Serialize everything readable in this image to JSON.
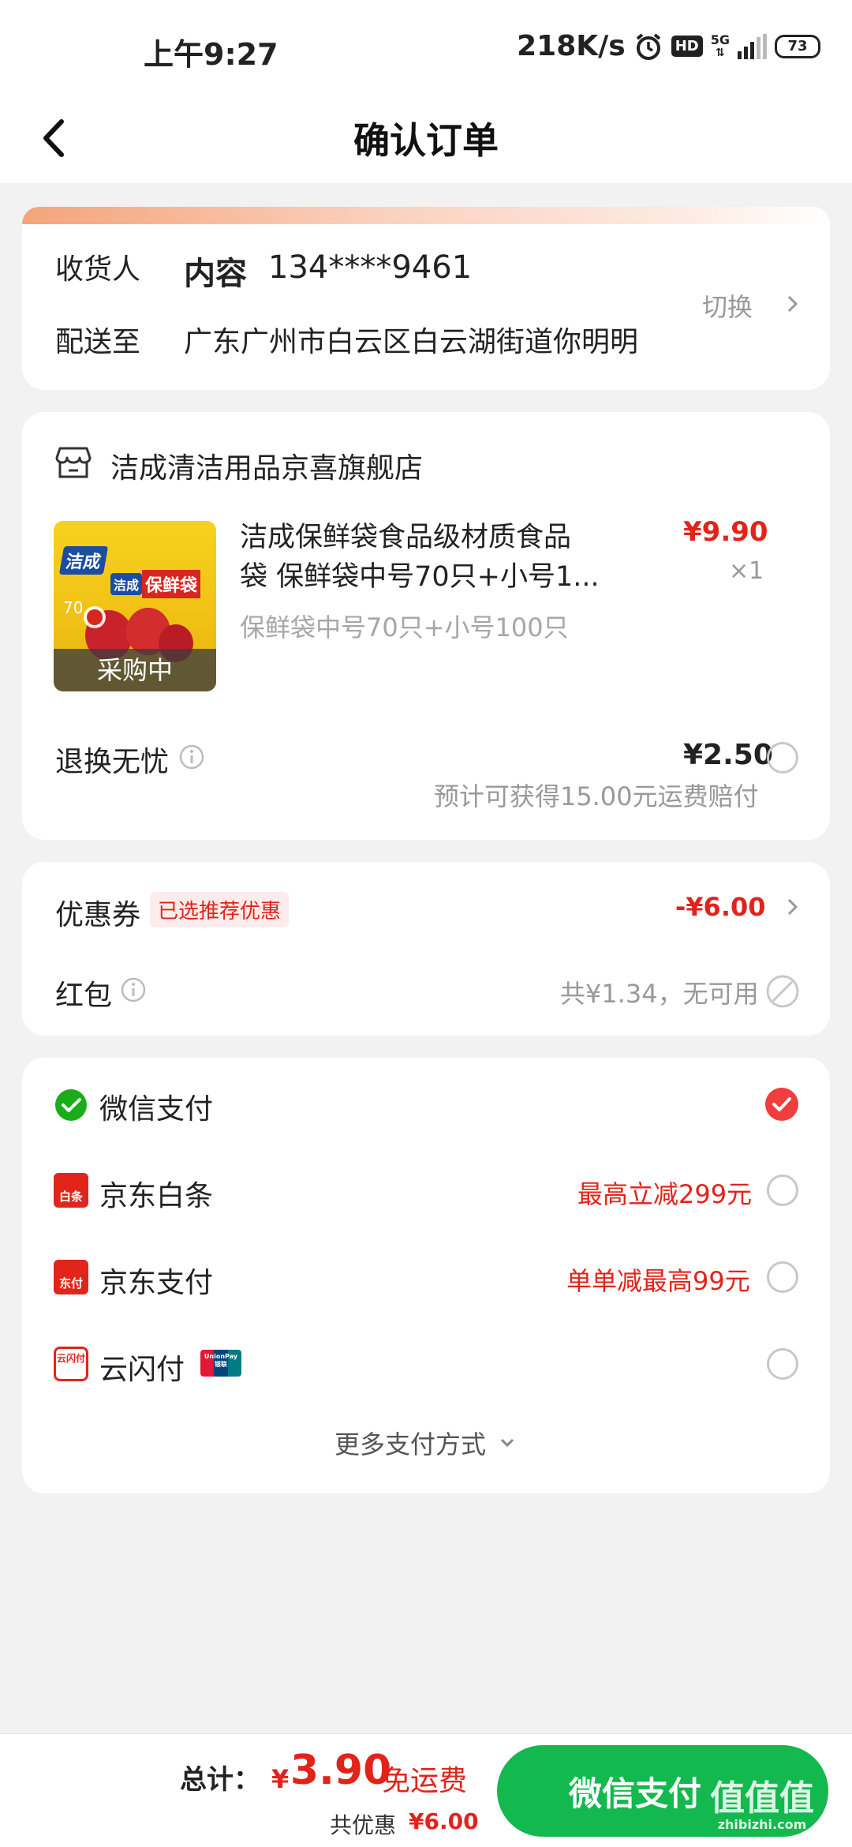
{
  "status_bar": {
    "time": "上午9:27",
    "net_speed": "218K/s",
    "hd": "HD",
    "net_type": "5G",
    "battery": "73"
  },
  "header": {
    "title": "确认订单"
  },
  "address": {
    "receiver_label": "收货人",
    "receiver_name": "内容",
    "receiver_phone": "134****9461",
    "deliver_label": "配送至",
    "deliver_address": "广东广州市白云区白云湖街道你明明",
    "switch_label": "切换"
  },
  "store": {
    "name": "洁成清洁用品京喜旗舰店",
    "product": {
      "title_line1": "洁成保鲜袋食品级材质食品",
      "title_line2": "袋 保鲜袋中号70只+小号1...",
      "price": "¥9.90",
      "qty": "×1",
      "spec": "保鲜袋中号70只+小号100只",
      "badge": "采购中",
      "img_brand": "洁成",
      "img_product": "保鲜袋",
      "img_count": "70"
    },
    "return": {
      "label": "退换无忧",
      "price": "¥2.50",
      "note": "预计可获得15.00元运费赔付"
    }
  },
  "discounts": {
    "coupon_label": "优惠券",
    "coupon_tag": "已选推荐优惠",
    "coupon_value": "-¥6.00",
    "redpack_label": "红包",
    "redpack_note": "共¥1.34，无可用"
  },
  "payment": {
    "options": [
      {
        "label": "微信支付",
        "promo": "",
        "selected": true
      },
      {
        "label": "京东白条",
        "promo": "最高立减299元",
        "selected": false
      },
      {
        "label": "京东支付",
        "promo": "单单减最高99元",
        "selected": false
      },
      {
        "label": "云闪付",
        "promo": "",
        "selected": false
      }
    ],
    "jd_baitiao_icon_text": "白条",
    "jd_pay_icon_text": "东付",
    "yunshanfu_icon_text": "云闪付",
    "unionpay_text": "UnionPay",
    "unionpay_cn": "银联",
    "more_label": "更多支付方式"
  },
  "bottom": {
    "total_label": "总计：",
    "currency": "¥",
    "total_value": "3.90",
    "free_shipping": "免运费",
    "saved_label": "共优惠",
    "saved_value": "¥6.00",
    "pay_button": "微信支付",
    "watermark": "值值值",
    "watermark_site": "zhibizhi.com"
  },
  "colors": {
    "accent_red": "#e2231a",
    "wechat_green": "#13b84e",
    "background": "#f2f2f2"
  }
}
